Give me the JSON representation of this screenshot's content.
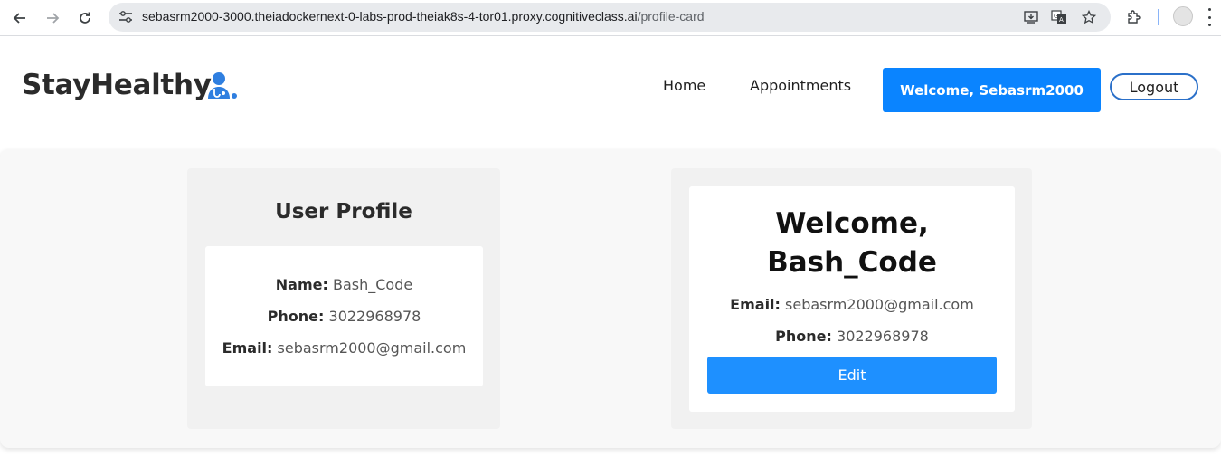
{
  "browser": {
    "url_host": "sebasrm2000-3000.theiadockernext-0-labs-prod-theiak8s-4-tor01.proxy.cognitiveclass.ai",
    "url_path": "/profile-card"
  },
  "site": {
    "logo_text": "StayHealthy",
    "nav": {
      "home": "Home",
      "appointments": "Appointments",
      "welcome": "Welcome, Sebasrm2000",
      "logout": "Logout"
    },
    "accent_color": "#0a84ff"
  },
  "profile_panel": {
    "title": "User Profile",
    "name_label": "Name:",
    "name_value": "Bash_Code",
    "phone_label": "Phone:",
    "phone_value": "3022968978",
    "email_label": "Email:",
    "email_value": "sebasrm2000@gmail.com"
  },
  "welcome_panel": {
    "title_line1": "Welcome,",
    "title_line2": "Bash_Code",
    "email_label": "Email:",
    "email_value": "sebasrm2000@gmail.com",
    "phone_label": "Phone:",
    "phone_value": "3022968978",
    "edit_label": "Edit"
  }
}
